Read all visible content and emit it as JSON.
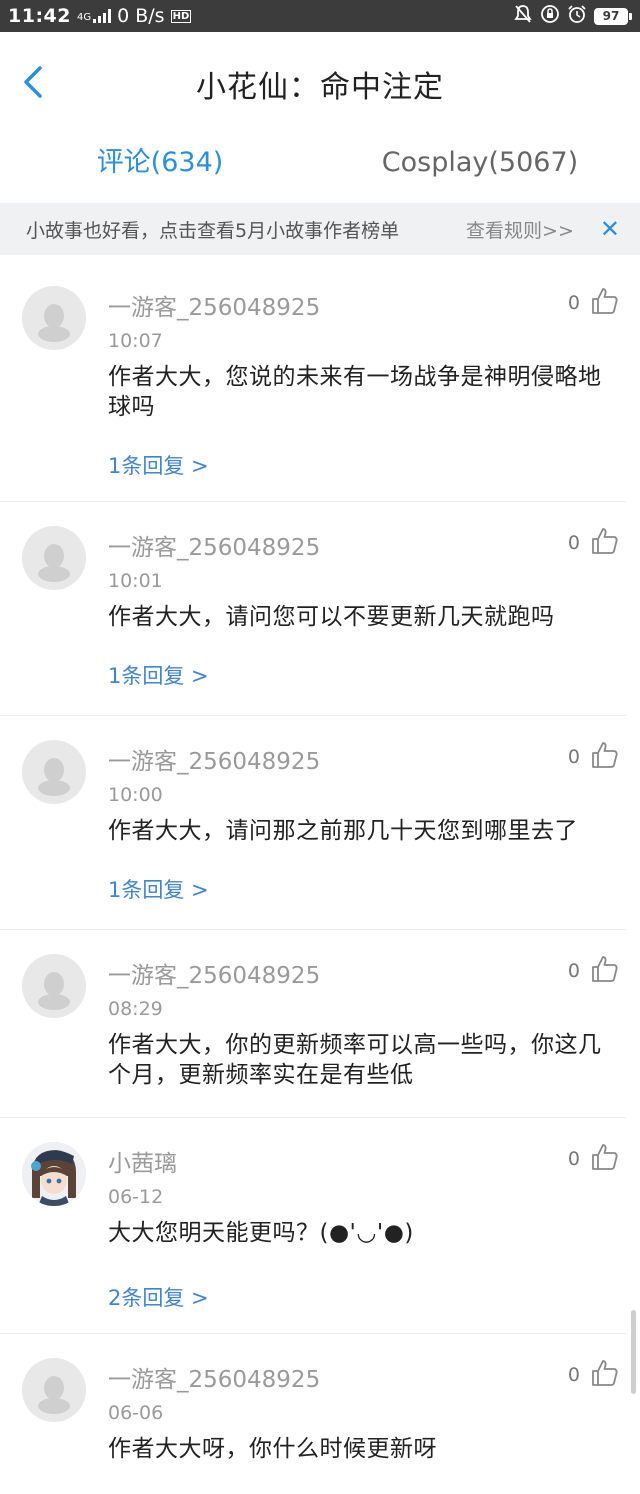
{
  "status_bar": {
    "time": "11:42",
    "network_label": "4G",
    "speed": "0 B/s",
    "hd_label": "HD",
    "battery": "97"
  },
  "header": {
    "title": "小花仙：命中注定"
  },
  "tabs": [
    {
      "label": "评论(634)",
      "active": true
    },
    {
      "label": "Cosplay(5067)",
      "active": false
    }
  ],
  "notice": {
    "text": "小故事也好看，点击查看5月小故事作者榜单",
    "rules_link": "查看规则>>",
    "close_label": "✕"
  },
  "colors": {
    "accent": "#2b8fe0",
    "reply_link": "#3f83d4",
    "status_bar_bg": "#3c3c3c"
  },
  "comments": [
    {
      "user": "一游客_256048925",
      "time": "10:07",
      "text": "作者大大，您说的未来有一场战争是神明侵略地球吗",
      "replies": "1条回复 >",
      "likes": "0",
      "avatar": "default-avatar-icon"
    },
    {
      "user": "一游客_256048925",
      "time": "10:01",
      "text": "作者大大，请问您可以不要更新几天就跑吗",
      "replies": "1条回复 >",
      "likes": "0",
      "avatar": "default-avatar-icon"
    },
    {
      "user": "一游客_256048925",
      "time": "10:00",
      "text": "作者大大，请问那之前那几十天您到哪里去了",
      "replies": "1条回复 >",
      "likes": "0",
      "avatar": "default-avatar-icon"
    },
    {
      "user": "一游客_256048925",
      "time": "08:29",
      "text": "作者大大，你的更新频率可以高一些吗，你这几个月，更新频率实在是有些低",
      "replies": "",
      "likes": "0",
      "avatar": "default-avatar-icon"
    },
    {
      "user": "小茜璃",
      "time": "06-12",
      "text": "大大您明天能更吗？(●'◡'●)",
      "replies": "2条回复 >",
      "likes": "0",
      "avatar": "anime-girl-avatar"
    },
    {
      "user": "一游客_256048925",
      "time": "06-06",
      "text": "作者大大呀，你什么时候更新呀",
      "replies": "",
      "likes": "0",
      "avatar": "default-avatar-icon"
    }
  ]
}
